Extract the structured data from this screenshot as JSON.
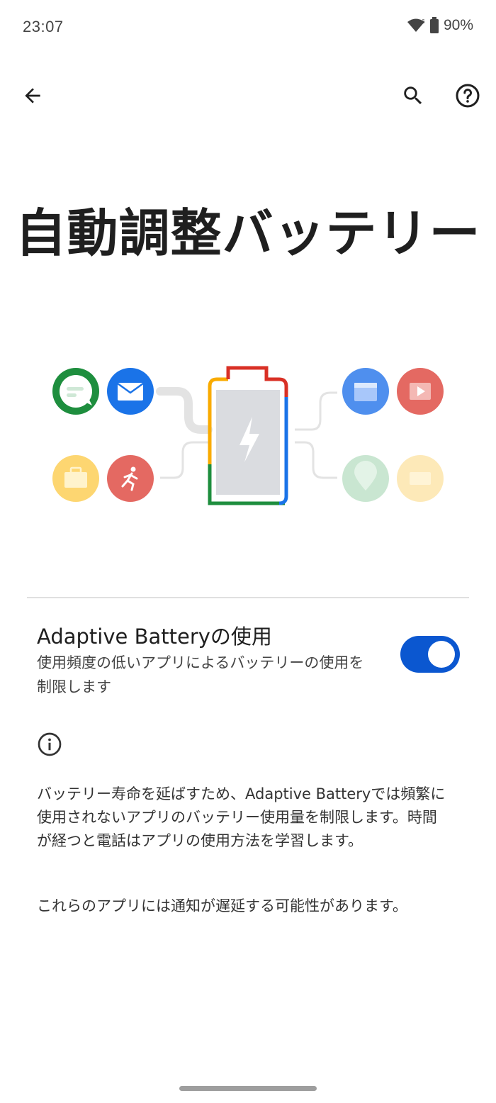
{
  "status_bar": {
    "time": "23:07",
    "battery_percent": "90%",
    "icons": [
      "wifi-icon",
      "battery-icon"
    ]
  },
  "toolbar": {
    "back_icon": "arrow-back-icon",
    "search_icon": "search-icon",
    "help_icon": "help-circle-icon"
  },
  "page": {
    "title": "自動調整バッテリー"
  },
  "illustration": {
    "left_icons": [
      "chat-icon",
      "mail-icon",
      "briefcase-icon",
      "running-icon"
    ],
    "right_icons": [
      "calendar-icon",
      "video-icon",
      "location-icon",
      "card-icon"
    ],
    "center": "battery-charging-icon"
  },
  "setting": {
    "title": "Adaptive Batteryの使用",
    "summary": "使用頻度の低いアプリによるバッテリーの使用を制限します",
    "enabled": true
  },
  "info": {
    "icon": "info-icon",
    "paragraph1": "バッテリー寿命を延ばすため、Adaptive Batteryでは頻繁に使用されないアプリのバッテリー使用量を制限します。時間が経つと電話はアプリの使用方法を学習します。",
    "paragraph2": "これらのアプリには通知が遅延する可能性があります。"
  },
  "colors": {
    "accent": "#0b57d0",
    "google_red": "#d93025",
    "google_yellow": "#f9ab00",
    "google_green": "#1e8e3e",
    "google_blue": "#1a73e8"
  }
}
